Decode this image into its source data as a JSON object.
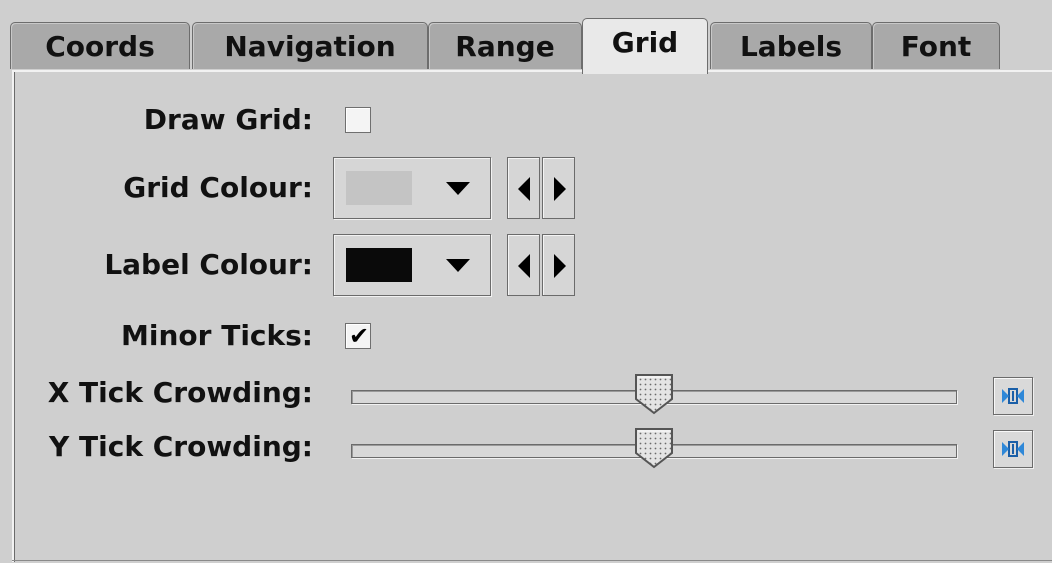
{
  "tabs": [
    {
      "label": "Coords",
      "active": false
    },
    {
      "label": "Navigation",
      "active": false
    },
    {
      "label": "Range",
      "active": false
    },
    {
      "label": "Grid",
      "active": true
    },
    {
      "label": "Labels",
      "active": false
    },
    {
      "label": "Font",
      "active": false
    }
  ],
  "grid": {
    "draw_grid": {
      "label": "Draw Grid:",
      "checked": false
    },
    "grid_colour": {
      "label": "Grid Colour:",
      "swatch_color": "#c4c4c4"
    },
    "label_colour": {
      "label": "Label Colour:",
      "swatch_color": "#0a0a0a"
    },
    "minor_ticks": {
      "label": "Minor Ticks:",
      "checked": true
    },
    "x_tick_crowding": {
      "label": "X Tick Crowding:",
      "value": 0.5
    },
    "y_tick_crowding": {
      "label": "Y Tick Crowding:",
      "value": 0.5
    }
  },
  "icons": {
    "combo_arrow": "triangle-down-icon",
    "prev": "triangle-left-icon",
    "next": "triangle-right-icon",
    "reset": "reset-crowding-icon"
  },
  "colors": {
    "background": "#cfcfcf",
    "active_tab": "#e9e9e9",
    "inactive_tab": "#a9a9a9",
    "reset_icon": "#1a73c8"
  }
}
